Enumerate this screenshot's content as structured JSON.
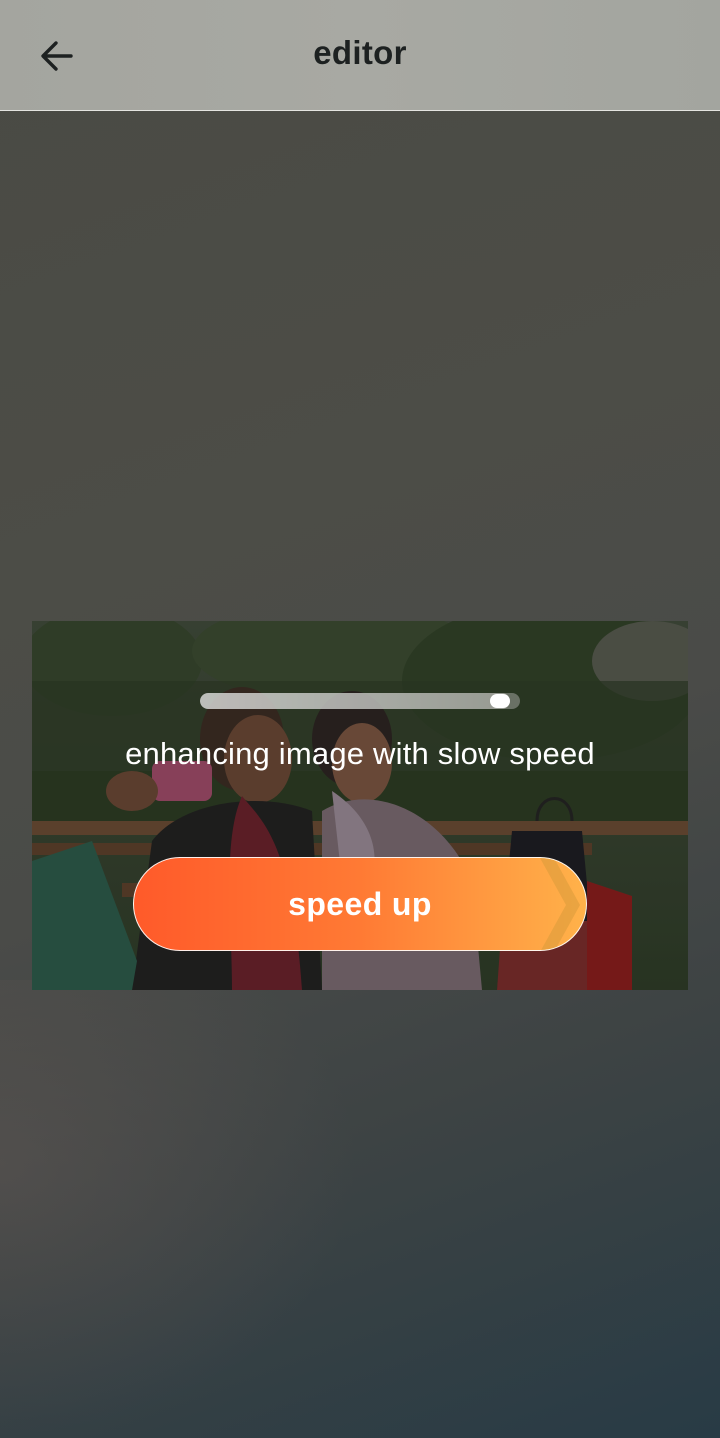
{
  "header": {
    "title": "editor",
    "back_icon": "arrow-left-icon"
  },
  "enhance": {
    "progress_fraction": 0.97,
    "status_text": "enhancing image with slow speed",
    "speed_up_label": "speed up"
  },
  "colors": {
    "header_bg": "#a6a7a1",
    "accent_start": "#ff5a2a",
    "accent_end": "#ffb24a",
    "text_light": "#ffffff",
    "text_dark": "#1d2121"
  }
}
